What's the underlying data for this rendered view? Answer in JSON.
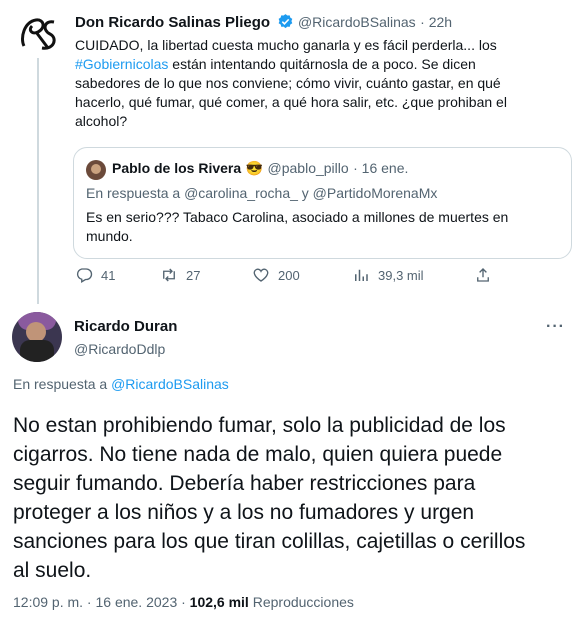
{
  "parent_tweet": {
    "author_name": "Don Ricardo Salinas Pliego",
    "author_handle": "@RicardoBSalinas",
    "time": "22h",
    "text_line1": "CUIDADO, la libertad cuesta mucho ganarla y es fácil perderla... los",
    "hashtag": "#Gobiernicolas",
    "text_line2_rest": " están intentando quitárnosla de a poco. Se dicen",
    "text_line3": "sabedores de lo que nos conviene; cómo vivir, cuánto gastar, en qué",
    "text_line4": "hacerlo, qué fumar, qué comer, a qué hora salir, etc. ¿que prohiban el",
    "text_line5": "alcohol?",
    "quote": {
      "author_name": "Pablo de los Rivera",
      "emoji": "😎",
      "author_handle": "@pablo_pillo",
      "time": "· 16 ene.",
      "reply_prefix": "En respuesta a ",
      "reply_to": "@carolina_rocha_ y @PartidoMorenaMx",
      "text_line1": "Es en serio??? Tabaco Carolina, asociado a millones de muertes en",
      "text_line2": "mundo."
    },
    "actions": {
      "replies": "41",
      "retweets": "27",
      "likes": "200",
      "views": "39,3 mil"
    }
  },
  "main_tweet": {
    "author_name": "Ricardo Duran",
    "author_handle": "@RicardoDdlp",
    "more_label": "···",
    "reply_prefix": "En respuesta a ",
    "reply_to": "@RicardoBSalinas",
    "text_line1": "No estan prohibiendo fumar, solo la publicidad de los",
    "text_line2": "cigarros. No tiene nada de malo, quien quiera puede",
    "text_line3": "seguir fumando. Debería haber restricciones para",
    "text_line4": "proteger a los niños y a los no fumadores y urgen",
    "text_line5": "sanciones para los que tiran colillas, cajetillas o cerillos",
    "text_line6": "al suelo.",
    "timestamp": "12:09 p. m. · 16 ene. 2023 · ",
    "views_count": "102,6 mil",
    "views_label": " Reproducciones"
  },
  "colors": {
    "accent": "#1d9bf0",
    "text": "#0f1419",
    "muted": "#536471",
    "border": "#cfd9de"
  }
}
